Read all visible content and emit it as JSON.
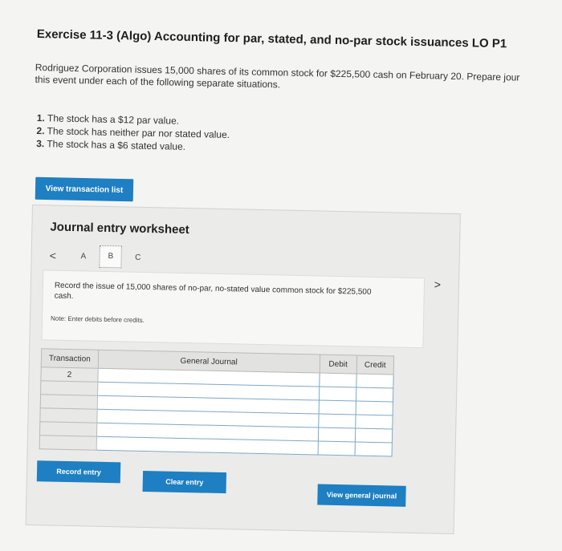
{
  "exercise": {
    "title": "Exercise 11-3 (Algo) Accounting for par, stated, and no-par stock issuances LO P1",
    "intro_line1": "Rodriguez Corporation issues 15,000 shares of its common stock for $225,500 cash on February 20. Prepare jour",
    "intro_line2": "this event under each of the following separate situations.",
    "situations": [
      {
        "num": "1.",
        "text": "The stock has a $12 par value."
      },
      {
        "num": "2.",
        "text": "The stock has neither par nor stated value."
      },
      {
        "num": "3.",
        "text": "The stock has a $6 stated value."
      }
    ],
    "view_transactions_label": "View transaction list"
  },
  "worksheet": {
    "title": "Journal entry worksheet",
    "prev_label": "<",
    "next_label": ">",
    "tabs": [
      "A",
      "B",
      "C"
    ],
    "active_tab": "B",
    "instruction": "Record the issue of 15,000 shares of no-par, no-stated value common stock for $225,500 cash.",
    "note": "Note: Enter debits before credits.",
    "table": {
      "headers": [
        "Transaction",
        "General Journal",
        "Debit",
        "Credit"
      ],
      "rows": [
        {
          "transaction": "2",
          "account": "",
          "debit": "",
          "credit": ""
        },
        {
          "transaction": "",
          "account": "",
          "debit": "",
          "credit": ""
        },
        {
          "transaction": "",
          "account": "",
          "debit": "",
          "credit": ""
        },
        {
          "transaction": "",
          "account": "",
          "debit": "",
          "credit": ""
        },
        {
          "transaction": "",
          "account": "",
          "debit": "",
          "credit": ""
        },
        {
          "transaction": "",
          "account": "",
          "debit": "",
          "credit": ""
        }
      ]
    },
    "buttons": {
      "record": "Record entry",
      "clear": "Clear entry",
      "view_general_journal": "View general journal"
    }
  },
  "colors": {
    "accent_button": "#1e7fc2",
    "page_background": "#f4f4f2"
  }
}
